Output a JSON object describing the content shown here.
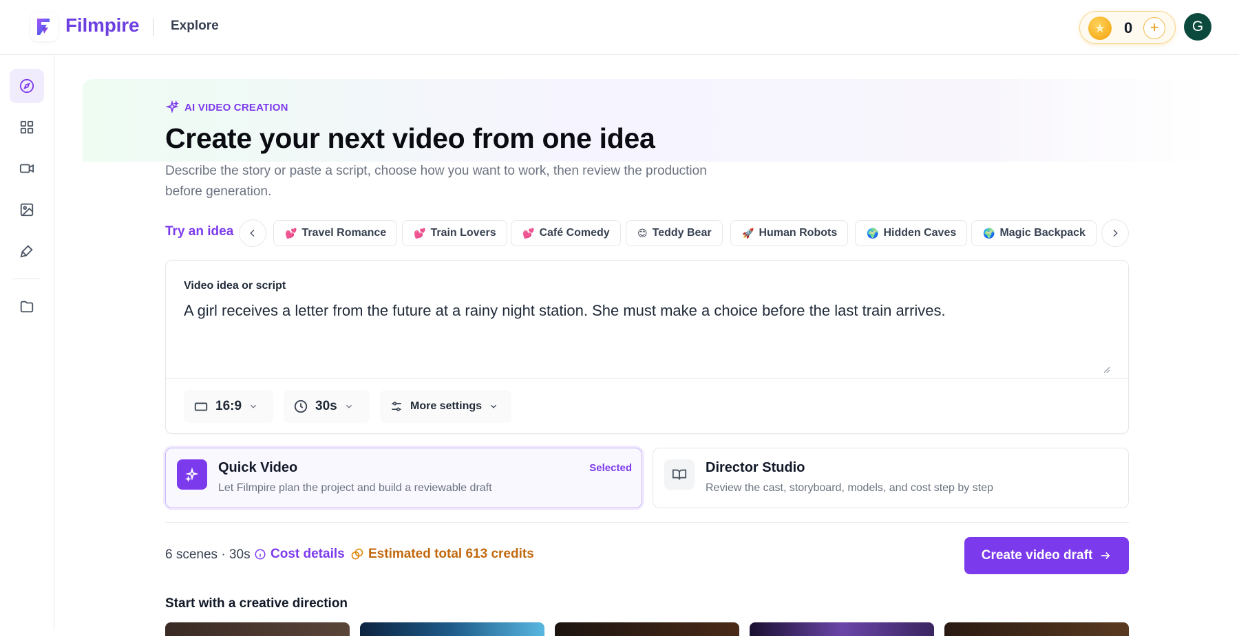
{
  "header": {
    "brand": "Filmpire",
    "nav_current": "Explore",
    "credits": "0",
    "avatar_initial": "G"
  },
  "sidebar": {
    "items": [
      {
        "icon": "compass-icon",
        "active": true
      },
      {
        "icon": "grid-icon",
        "active": false
      },
      {
        "icon": "video-icon",
        "active": false
      },
      {
        "icon": "image-icon",
        "active": false
      },
      {
        "icon": "brush-icon",
        "active": false
      },
      {
        "icon": "folder-icon",
        "active": false
      }
    ]
  },
  "hero": {
    "eyebrow": "AI VIDEO CREATION",
    "title": "Create your next video from one idea",
    "subtitle": "Describe the story or paste a script, choose how you want to work, then review the production before generation."
  },
  "ideas": {
    "label": "Try an idea",
    "chips": [
      {
        "emoji": "💕",
        "label": "Travel Romance"
      },
      {
        "emoji": "💕",
        "label": "Train Lovers"
      },
      {
        "emoji": "💕",
        "label": "Café Comedy"
      },
      {
        "emoji": "😊",
        "label": "Teddy Bear"
      },
      {
        "emoji": "🚀",
        "label": "Human Robots"
      },
      {
        "emoji": "🌍",
        "label": "Hidden Caves"
      },
      {
        "emoji": "🌍",
        "label": "Magic Backpack"
      }
    ]
  },
  "prompt": {
    "label": "Video idea or script",
    "value": "A girl receives a letter from the future at a rainy night station. She must make a choice before the last train arrives.",
    "aspect_ratio": "16:9",
    "duration": "30s",
    "more_settings": "More settings"
  },
  "modes": {
    "quick": {
      "title": "Quick Video",
      "description": "Let Filmpire plan the project and build a reviewable draft",
      "badge": "Selected"
    },
    "director": {
      "title": "Director Studio",
      "description": "Review the cast, storyboard, models, and cost step by step"
    }
  },
  "summary": {
    "meta": "6 scenes · 30s",
    "cost_details": "Cost details",
    "estimate": "Estimated total 613 credits",
    "create_button": "Create video draft"
  },
  "directions": {
    "title": "Start with a creative direction"
  },
  "colors": {
    "accent": "#7c3aed",
    "estimate": "#c2690e",
    "avatar": "#0b4a3c"
  }
}
